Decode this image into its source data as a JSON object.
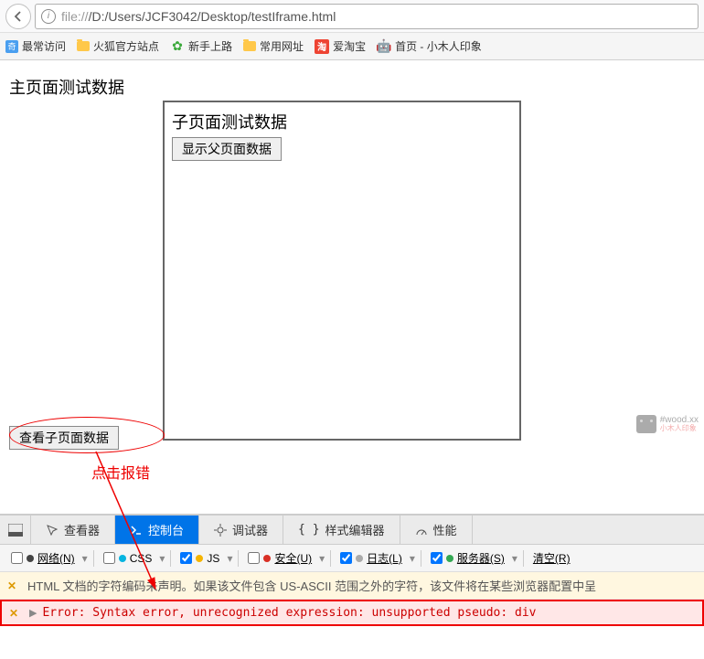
{
  "nav": {
    "url_prefix": "file://",
    "url_path": "/D:/Users/JCF3042/Desktop/testIframe.html"
  },
  "bookmarks": {
    "most_visited": "最常访问",
    "firefox_official": "火狐官方站点",
    "new_to_road": "新手上路",
    "common_urls": "常用网址",
    "aitaobao": "爱淘宝",
    "home_xmr": "首页 - 小木人印象"
  },
  "page": {
    "main_title": "主页面测试数据",
    "sub_title": "子页面测试数据",
    "show_parent_btn": "显示父页面数据",
    "view_child_btn": "查看子页面数据"
  },
  "annotation": {
    "text": "点击报错"
  },
  "watermark": {
    "line1": "#wood.xx",
    "line2": "小木人印象"
  },
  "devtools": {
    "tabs": {
      "inspector": "查看器",
      "console": "控制台",
      "debugger": "调试器",
      "style_editor": "样式编辑器",
      "performance": "性能"
    },
    "filters": {
      "network": "网络(N)",
      "css": "CSS",
      "js": "JS",
      "security": "安全(U)",
      "log": "日志(L)",
      "server": "服务器(S)",
      "clear": "清空(R)"
    },
    "logs": {
      "warn": "HTML 文档的字符编码未声明。如果该文件包含 US-ASCII 范围之外的字符，该文件将在某些浏览器配置中呈",
      "error": "Error: Syntax error, unrecognized expression: unsupported pseudo: div"
    }
  }
}
